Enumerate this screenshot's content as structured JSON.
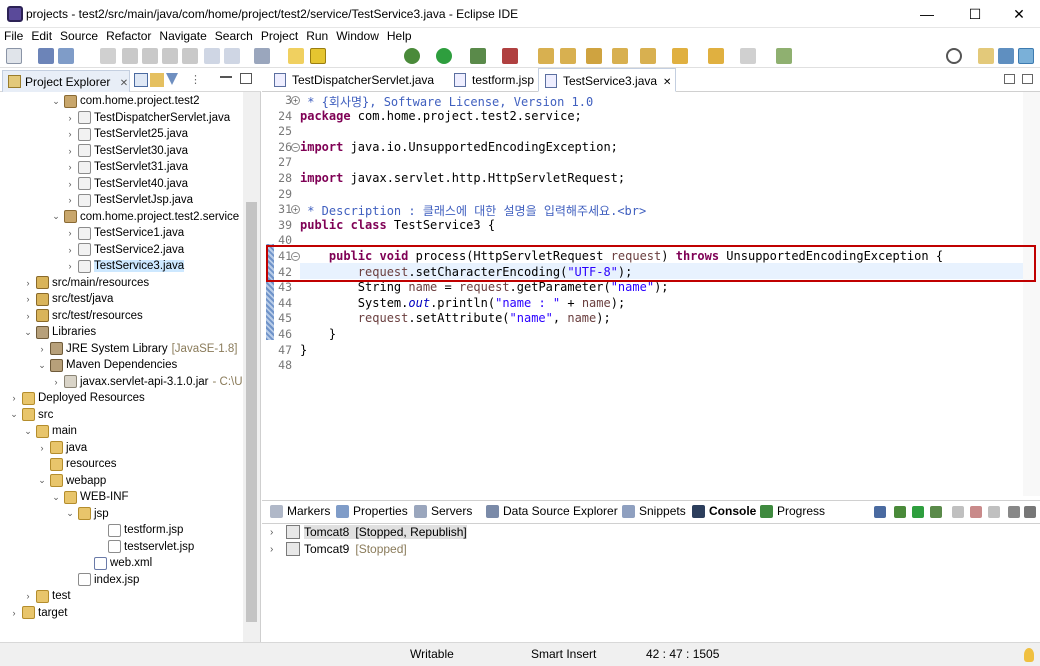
{
  "window": {
    "title": "projects - test2/src/main/java/com/home/project/test2/service/TestService3.java - Eclipse IDE",
    "min_glyph": "—",
    "max_glyph": "☐",
    "close_glyph": "✕"
  },
  "menu": [
    "File",
    "Edit",
    "Source",
    "Refactor",
    "Navigate",
    "Search",
    "Project",
    "Run",
    "Window",
    "Help"
  ],
  "explorer": {
    "tab_label": "Project Explorer",
    "close_glyph": "✕",
    "items": [
      {
        "label": "com.home.project.test2",
        "icon": "package-icon",
        "twisty": "⌄"
      },
      {
        "label": "TestDispatcherServlet.java",
        "icon": "java-file-icon",
        "twisty": "›"
      },
      {
        "label": "TestServlet25.java",
        "icon": "java-file-icon",
        "twisty": "›"
      },
      {
        "label": "TestServlet30.java",
        "icon": "java-file-icon",
        "twisty": "›"
      },
      {
        "label": "TestServlet31.java",
        "icon": "java-file-icon",
        "twisty": "›"
      },
      {
        "label": "TestServlet40.java",
        "icon": "java-file-icon",
        "twisty": "›"
      },
      {
        "label": "TestServletJsp.java",
        "icon": "java-file-icon",
        "twisty": "›"
      },
      {
        "label": "com.home.project.test2.service",
        "icon": "package-icon",
        "twisty": "⌄"
      },
      {
        "label": "TestService1.java",
        "icon": "java-file-icon",
        "twisty": "›"
      },
      {
        "label": "TestService2.java",
        "icon": "java-file-icon",
        "twisty": "›"
      },
      {
        "label": "TestService3.java",
        "icon": "java-file-icon",
        "twisty": "›",
        "selected": true
      },
      {
        "label": "src/main/resources",
        "icon": "source-folder-icon",
        "twisty": "›"
      },
      {
        "label": "src/test/java",
        "icon": "source-folder-icon",
        "twisty": "›"
      },
      {
        "label": "src/test/resources",
        "icon": "source-folder-icon",
        "twisty": "›"
      },
      {
        "label": "Libraries",
        "icon": "library-icon",
        "twisty": "⌄"
      },
      {
        "label": "JRE System Library",
        "suffix": "[JavaSE-1.8]",
        "icon": "library-icon",
        "twisty": "›"
      },
      {
        "label": "Maven Dependencies",
        "icon": "library-icon",
        "twisty": "⌄"
      },
      {
        "label": "javax.servlet-api-3.1.0.jar",
        "suffix": "- C:\\U",
        "icon": "jar-icon",
        "twisty": "›"
      },
      {
        "label": "Deployed Resources",
        "icon": "folder-icon",
        "twisty": "›"
      },
      {
        "label": "src",
        "icon": "folder-icon",
        "twisty": "⌄"
      },
      {
        "label": "main",
        "icon": "folder-icon",
        "twisty": "⌄"
      },
      {
        "label": "java",
        "icon": "folder-icon",
        "twisty": "›"
      },
      {
        "label": "resources",
        "icon": "folder-icon",
        "twisty": ""
      },
      {
        "label": "webapp",
        "icon": "folder-icon",
        "twisty": "⌄"
      },
      {
        "label": "WEB-INF",
        "icon": "folder-icon",
        "twisty": "⌄"
      },
      {
        "label": "jsp",
        "icon": "folder-icon",
        "twisty": "⌄"
      },
      {
        "label": "testform.jsp",
        "icon": "file-icon",
        "twisty": ""
      },
      {
        "label": "testservlet.jsp",
        "icon": "file-icon",
        "twisty": ""
      },
      {
        "label": "web.xml",
        "icon": "xml-file-icon",
        "twisty": ""
      },
      {
        "label": "index.jsp",
        "icon": "file-icon",
        "twisty": ""
      },
      {
        "label": "test",
        "icon": "folder-icon",
        "twisty": "›"
      },
      {
        "label": "target",
        "icon": "folder-icon",
        "twisty": "›"
      }
    ]
  },
  "editor": {
    "tabs": [
      {
        "label": "TestDispatcherServlet.java",
        "active": false
      },
      {
        "label": "testform.jsp",
        "active": false
      },
      {
        "label": "TestService3.java",
        "active": true,
        "close": "✕"
      }
    ],
    "lines": [
      {
        "n": "3",
        "fold": "⊕",
        "html": "<span class=\"cm\"> * {회사명}, Software License, Version 1.0</span>"
      },
      {
        "n": "24",
        "fold": "",
        "html": "<span class=\"kw\">package</span> com.home.project.test2.service;"
      },
      {
        "n": "25",
        "fold": "",
        "html": ""
      },
      {
        "n": "26",
        "fold": "⊖",
        "html": "<span class=\"kw\">import</span> java.io.UnsupportedEncodingException;"
      },
      {
        "n": "27",
        "fold": "",
        "html": ""
      },
      {
        "n": "28",
        "fold": "",
        "html": "<span class=\"kw\">import</span> javax.servlet.http.HttpServletRequest;"
      },
      {
        "n": "29",
        "fold": "",
        "html": ""
      },
      {
        "n": "31",
        "fold": "⊕",
        "html": "<span class=\"cm\"> * Description : 클래스에 대한 설명을 입력해주세요.&lt;br&gt;</span>"
      },
      {
        "n": "39",
        "fold": "",
        "html": "<span class=\"kw\">public class</span> TestService3 {"
      },
      {
        "n": "40",
        "fold": "",
        "html": ""
      },
      {
        "n": "41",
        "fold": "⊖",
        "html": "    <span class=\"kw\">public void</span> process(HttpServletRequest <span class=\"param\">request</span>) <span class=\"kw\">throws</span> UnsupportedEncodingException {"
      },
      {
        "n": "42",
        "fold": "",
        "html": "        <span class=\"param\">request</span>.setCharacterEncoding(<span class=\"str\">\"UTF-8\"</span>);"
      },
      {
        "n": "43",
        "fold": "",
        "html": "        String <span class=\"param\">name</span> = <span class=\"param\">request</span>.getParameter(<span class=\"str\">\"name\"</span>);"
      },
      {
        "n": "44",
        "fold": "",
        "html": "        System.<span class=\"fld\">out</span>.println(<span class=\"str\">\"name : \"</span> + <span class=\"param\">name</span>);"
      },
      {
        "n": "45",
        "fold": "",
        "html": "        <span class=\"param\">request</span>.setAttribute(<span class=\"str\">\"name\"</span>, <span class=\"param\">name</span>);"
      },
      {
        "n": "46",
        "fold": "",
        "html": "    }"
      },
      {
        "n": "47",
        "fold": "",
        "html": "}"
      },
      {
        "n": "48",
        "fold": "",
        "html": ""
      }
    ]
  },
  "bottom_panel": {
    "tabs": [
      "Markers",
      "Properties",
      "Servers",
      "Data Source Explorer",
      "Snippets",
      "Console",
      "Progress"
    ],
    "servers": [
      {
        "name": "Tomcat8",
        "state": "[Stopped, Republish]",
        "selected": true
      },
      {
        "name": "Tomcat9",
        "state": "[Stopped]",
        "selected": false
      }
    ]
  },
  "status": {
    "mode": "Writable",
    "insert": "Smart Insert",
    "position": "42 : 47 : 1505"
  },
  "colors": {
    "highlight_box": "#c00000",
    "selection": "#cde8ff",
    "keyword": "#7f0055",
    "string": "#2a00ff",
    "comment": "#3f5fbf"
  }
}
